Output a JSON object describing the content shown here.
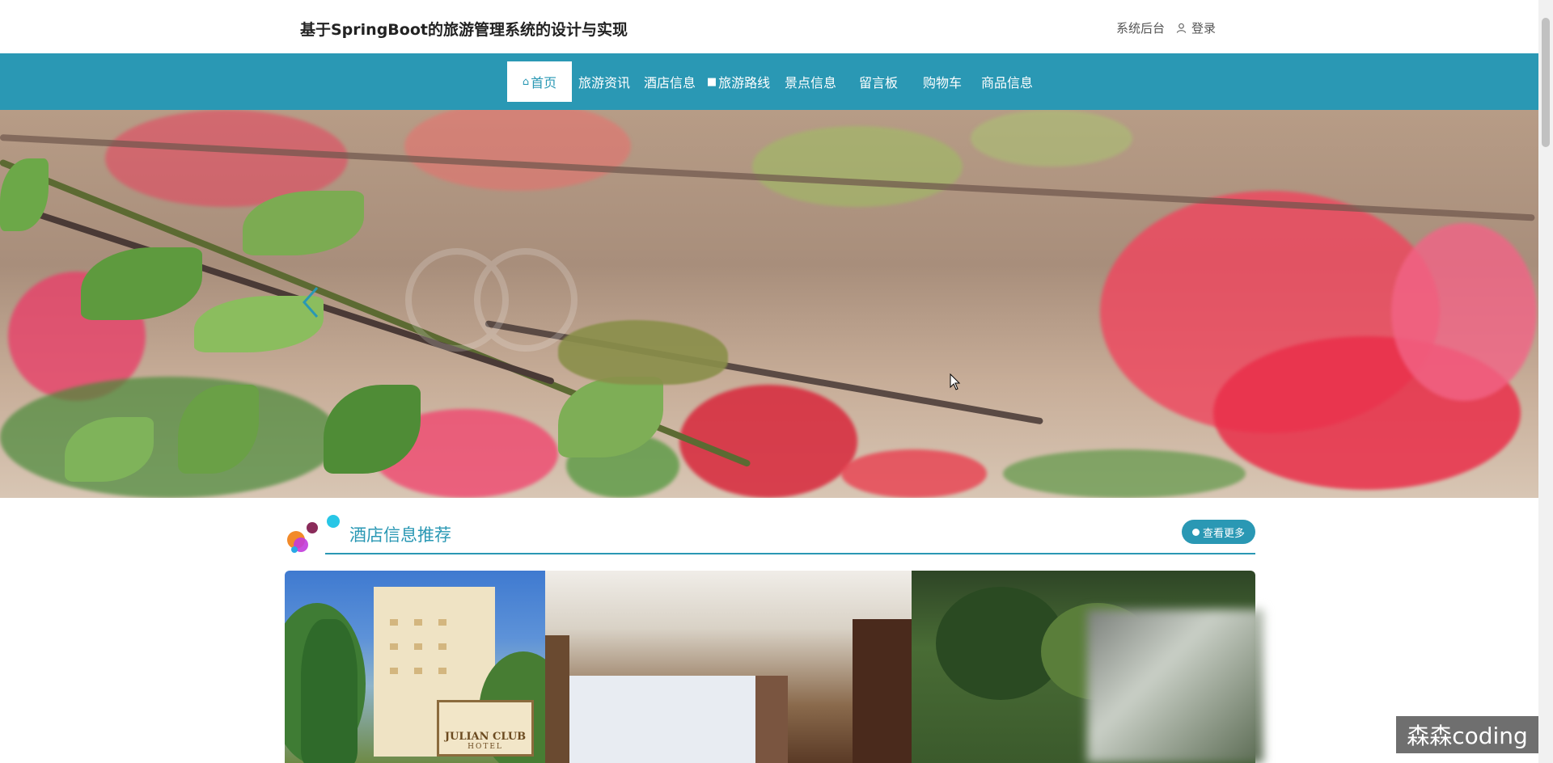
{
  "header": {
    "title": "基于SpringBoot的旅游管理系统的设计与实现",
    "admin_link": "系统后台",
    "login_link": "登录"
  },
  "nav": {
    "items": [
      {
        "label": "首页",
        "icon": "home-icon"
      },
      {
        "label": "旅游资讯"
      },
      {
        "label": "酒店信息"
      },
      {
        "label": "旅游路线",
        "icon": "square-icon"
      },
      {
        "label": "景点信息"
      },
      {
        "label": "留言板"
      },
      {
        "label": "购物车"
      },
      {
        "label": "商品信息"
      }
    ]
  },
  "section": {
    "title": "酒店信息推荐",
    "more_label": "查看更多"
  },
  "cards": {
    "card1_sign_line1": "JULIAN CLUB",
    "card1_sign_line2": "HOTEL"
  },
  "overlay": {
    "channel_label": "森森coding"
  },
  "colors": {
    "accent": "#2a98b4",
    "header_bg": "#ffffff"
  }
}
